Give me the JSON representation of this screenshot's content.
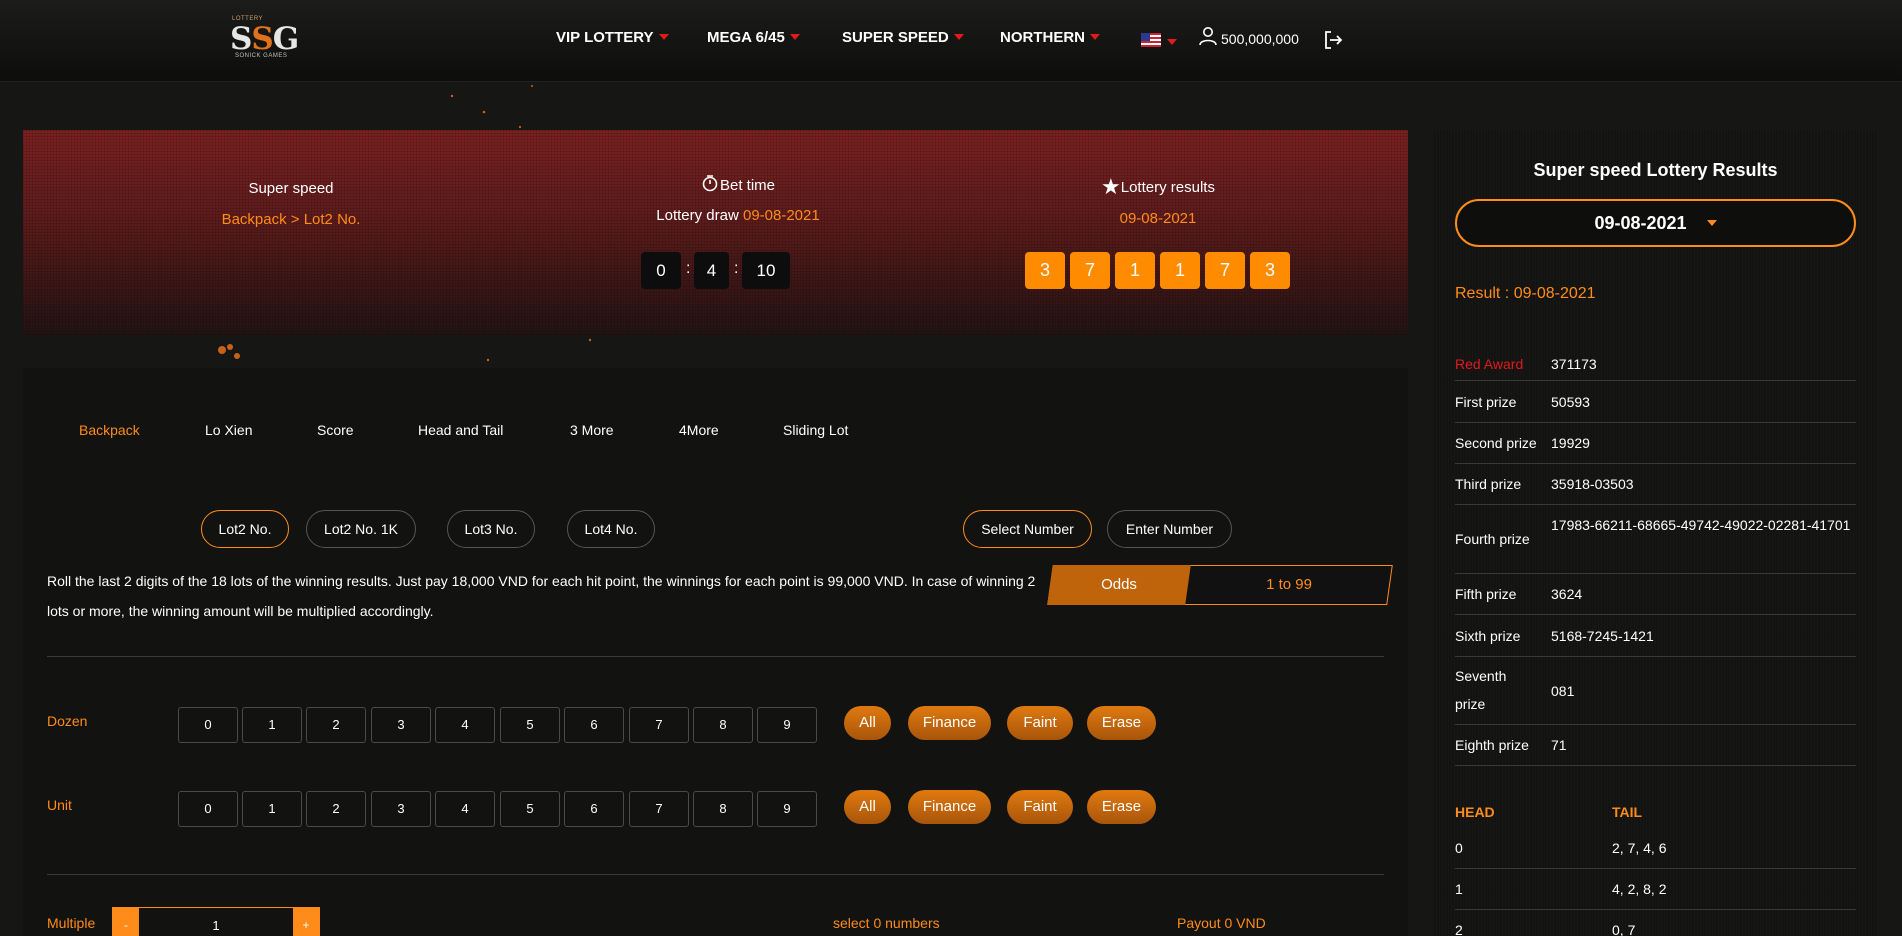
{
  "brand": {
    "top": "LOTTERY",
    "mark_left": "S",
    "mark_mid": "S",
    "mark_right": "G",
    "sub": "SONICK GAMES"
  },
  "nav": {
    "items": [
      {
        "label": "VIP LOTTERY"
      },
      {
        "label": "MEGA 6/45"
      },
      {
        "label": "SUPER SPEED"
      },
      {
        "label": "NORTHERN"
      }
    ],
    "balance": "500,000,000",
    "icons": [
      "flag-us-icon",
      "user-icon",
      "logout-icon"
    ]
  },
  "header": {
    "game": "Super speed",
    "breadcrumb": "Backpack > Lot2 No.",
    "bet_time_label": "Bet time",
    "draw_label": "Lottery draw",
    "draw_date": "09-08-2021",
    "timer": {
      "h": "0",
      "m": "4",
      "s": "10"
    },
    "results_label": "Lottery results",
    "results_date": "09-08-2021",
    "results_digits": [
      "3",
      "7",
      "1",
      "1",
      "7",
      "3"
    ]
  },
  "tabs": [
    "Backpack",
    "Lo Xien",
    "Score",
    "Head and Tail",
    "3 More",
    "4More",
    "Sliding Lot"
  ],
  "sub_tabs": [
    "Lot2 No.",
    "Lot2 No. 1K",
    "Lot3 No.",
    "Lot4 No."
  ],
  "mode_tabs": [
    "Select Number",
    "Enter Number"
  ],
  "description": "Roll the last 2 digits of the 18 lots of the winning results. Just pay 18,000 VND for each hit point, the winnings for each point is 99,000 VND. In case of winning 2 lots or more, the winning amount will be multiplied accordingly.",
  "odds": {
    "label": "Odds",
    "value": "1 to 99"
  },
  "rows": [
    {
      "label": "Dozen",
      "digits": [
        "0",
        "1",
        "2",
        "3",
        "4",
        "5",
        "6",
        "7",
        "8",
        "9"
      ]
    },
    {
      "label": "Unit",
      "digits": [
        "0",
        "1",
        "2",
        "3",
        "4",
        "5",
        "6",
        "7",
        "8",
        "9"
      ]
    }
  ],
  "actions": [
    "All",
    "Finance",
    "Faint",
    "Erase"
  ],
  "bottom": {
    "multiple_label": "Multiple",
    "minus": "-",
    "plus": "+",
    "quantity": "1",
    "selected": "select 0 numbers",
    "payout": "Payout 0 VND"
  },
  "sidebar": {
    "title": "Super speed Lottery Results",
    "date": "09-08-2021",
    "result_label": "Result : 09-08-2021",
    "prizes": [
      {
        "name": "Red Award",
        "value": "371173"
      },
      {
        "name": "First prize",
        "value": "50593"
      },
      {
        "name": "Second prize",
        "value": "19929"
      },
      {
        "name": "Third prize",
        "value": "35918-03503"
      },
      {
        "name": "Fourth prize",
        "value": "17983-66211-68665-49742-49022-02281-41701"
      },
      {
        "name": "Fifth prize",
        "value": "3624"
      },
      {
        "name": "Sixth prize",
        "value": "5168-7245-1421"
      },
      {
        "name": "Seventh prize",
        "value": "081"
      },
      {
        "name": "Eighth prize",
        "value": "71"
      }
    ],
    "head_label": "HEAD",
    "tail_label": "TAIL",
    "head_tail": [
      {
        "head": "0",
        "tail": "2, 7, 4, 6"
      },
      {
        "head": "1",
        "tail": "4, 2, 8, 2"
      },
      {
        "head": "2",
        "tail": "0, 7"
      }
    ]
  },
  "colors": {
    "accent": "#ff8c1a",
    "red": "#e01b1b",
    "bg": "#161614"
  }
}
